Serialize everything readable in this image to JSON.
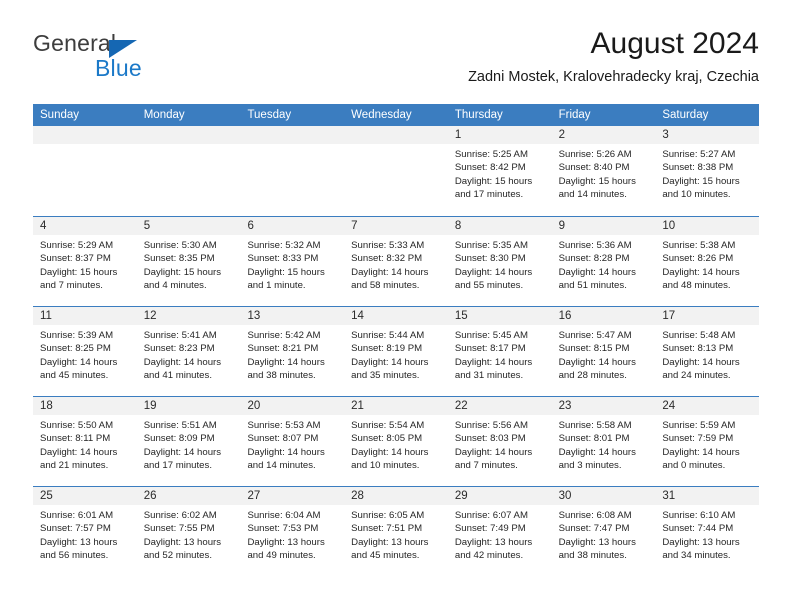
{
  "brand": {
    "name_top": "General",
    "name_bottom": "Blue",
    "triangle_color": "#1567b3",
    "blue_color": "#1b79c8"
  },
  "header": {
    "title": "August 2024",
    "location": "Zadni Mostek, Kralovehradecky kraj, Czechia"
  },
  "theme": {
    "header_row_color": "#3b7dc0",
    "day_band_color": "#f2f2f2",
    "rule_color": "#3b7dc0"
  },
  "calendar": {
    "weekdays": [
      "Sunday",
      "Monday",
      "Tuesday",
      "Wednesday",
      "Thursday",
      "Friday",
      "Saturday"
    ],
    "weeks": [
      [
        {
          "day": "",
          "empty": true
        },
        {
          "day": "",
          "empty": true
        },
        {
          "day": "",
          "empty": true
        },
        {
          "day": "",
          "empty": true
        },
        {
          "day": "1",
          "sunrise": "Sunrise: 5:25 AM",
          "sunset": "Sunset: 8:42 PM",
          "daylight1": "Daylight: 15 hours",
          "daylight2": "and 17 minutes."
        },
        {
          "day": "2",
          "sunrise": "Sunrise: 5:26 AM",
          "sunset": "Sunset: 8:40 PM",
          "daylight1": "Daylight: 15 hours",
          "daylight2": "and 14 minutes."
        },
        {
          "day": "3",
          "sunrise": "Sunrise: 5:27 AM",
          "sunset": "Sunset: 8:38 PM",
          "daylight1": "Daylight: 15 hours",
          "daylight2": "and 10 minutes."
        }
      ],
      [
        {
          "day": "4",
          "sunrise": "Sunrise: 5:29 AM",
          "sunset": "Sunset: 8:37 PM",
          "daylight1": "Daylight: 15 hours",
          "daylight2": "and 7 minutes."
        },
        {
          "day": "5",
          "sunrise": "Sunrise: 5:30 AM",
          "sunset": "Sunset: 8:35 PM",
          "daylight1": "Daylight: 15 hours",
          "daylight2": "and 4 minutes."
        },
        {
          "day": "6",
          "sunrise": "Sunrise: 5:32 AM",
          "sunset": "Sunset: 8:33 PM",
          "daylight1": "Daylight: 15 hours",
          "daylight2": "and 1 minute."
        },
        {
          "day": "7",
          "sunrise": "Sunrise: 5:33 AM",
          "sunset": "Sunset: 8:32 PM",
          "daylight1": "Daylight: 14 hours",
          "daylight2": "and 58 minutes."
        },
        {
          "day": "8",
          "sunrise": "Sunrise: 5:35 AM",
          "sunset": "Sunset: 8:30 PM",
          "daylight1": "Daylight: 14 hours",
          "daylight2": "and 55 minutes."
        },
        {
          "day": "9",
          "sunrise": "Sunrise: 5:36 AM",
          "sunset": "Sunset: 8:28 PM",
          "daylight1": "Daylight: 14 hours",
          "daylight2": "and 51 minutes."
        },
        {
          "day": "10",
          "sunrise": "Sunrise: 5:38 AM",
          "sunset": "Sunset: 8:26 PM",
          "daylight1": "Daylight: 14 hours",
          "daylight2": "and 48 minutes."
        }
      ],
      [
        {
          "day": "11",
          "sunrise": "Sunrise: 5:39 AM",
          "sunset": "Sunset: 8:25 PM",
          "daylight1": "Daylight: 14 hours",
          "daylight2": "and 45 minutes."
        },
        {
          "day": "12",
          "sunrise": "Sunrise: 5:41 AM",
          "sunset": "Sunset: 8:23 PM",
          "daylight1": "Daylight: 14 hours",
          "daylight2": "and 41 minutes."
        },
        {
          "day": "13",
          "sunrise": "Sunrise: 5:42 AM",
          "sunset": "Sunset: 8:21 PM",
          "daylight1": "Daylight: 14 hours",
          "daylight2": "and 38 minutes."
        },
        {
          "day": "14",
          "sunrise": "Sunrise: 5:44 AM",
          "sunset": "Sunset: 8:19 PM",
          "daylight1": "Daylight: 14 hours",
          "daylight2": "and 35 minutes."
        },
        {
          "day": "15",
          "sunrise": "Sunrise: 5:45 AM",
          "sunset": "Sunset: 8:17 PM",
          "daylight1": "Daylight: 14 hours",
          "daylight2": "and 31 minutes."
        },
        {
          "day": "16",
          "sunrise": "Sunrise: 5:47 AM",
          "sunset": "Sunset: 8:15 PM",
          "daylight1": "Daylight: 14 hours",
          "daylight2": "and 28 minutes."
        },
        {
          "day": "17",
          "sunrise": "Sunrise: 5:48 AM",
          "sunset": "Sunset: 8:13 PM",
          "daylight1": "Daylight: 14 hours",
          "daylight2": "and 24 minutes."
        }
      ],
      [
        {
          "day": "18",
          "sunrise": "Sunrise: 5:50 AM",
          "sunset": "Sunset: 8:11 PM",
          "daylight1": "Daylight: 14 hours",
          "daylight2": "and 21 minutes."
        },
        {
          "day": "19",
          "sunrise": "Sunrise: 5:51 AM",
          "sunset": "Sunset: 8:09 PM",
          "daylight1": "Daylight: 14 hours",
          "daylight2": "and 17 minutes."
        },
        {
          "day": "20",
          "sunrise": "Sunrise: 5:53 AM",
          "sunset": "Sunset: 8:07 PM",
          "daylight1": "Daylight: 14 hours",
          "daylight2": "and 14 minutes."
        },
        {
          "day": "21",
          "sunrise": "Sunrise: 5:54 AM",
          "sunset": "Sunset: 8:05 PM",
          "daylight1": "Daylight: 14 hours",
          "daylight2": "and 10 minutes."
        },
        {
          "day": "22",
          "sunrise": "Sunrise: 5:56 AM",
          "sunset": "Sunset: 8:03 PM",
          "daylight1": "Daylight: 14 hours",
          "daylight2": "and 7 minutes."
        },
        {
          "day": "23",
          "sunrise": "Sunrise: 5:58 AM",
          "sunset": "Sunset: 8:01 PM",
          "daylight1": "Daylight: 14 hours",
          "daylight2": "and 3 minutes."
        },
        {
          "day": "24",
          "sunrise": "Sunrise: 5:59 AM",
          "sunset": "Sunset: 7:59 PM",
          "daylight1": "Daylight: 14 hours",
          "daylight2": "and 0 minutes."
        }
      ],
      [
        {
          "day": "25",
          "sunrise": "Sunrise: 6:01 AM",
          "sunset": "Sunset: 7:57 PM",
          "daylight1": "Daylight: 13 hours",
          "daylight2": "and 56 minutes."
        },
        {
          "day": "26",
          "sunrise": "Sunrise: 6:02 AM",
          "sunset": "Sunset: 7:55 PM",
          "daylight1": "Daylight: 13 hours",
          "daylight2": "and 52 minutes."
        },
        {
          "day": "27",
          "sunrise": "Sunrise: 6:04 AM",
          "sunset": "Sunset: 7:53 PM",
          "daylight1": "Daylight: 13 hours",
          "daylight2": "and 49 minutes."
        },
        {
          "day": "28",
          "sunrise": "Sunrise: 6:05 AM",
          "sunset": "Sunset: 7:51 PM",
          "daylight1": "Daylight: 13 hours",
          "daylight2": "and 45 minutes."
        },
        {
          "day": "29",
          "sunrise": "Sunrise: 6:07 AM",
          "sunset": "Sunset: 7:49 PM",
          "daylight1": "Daylight: 13 hours",
          "daylight2": "and 42 minutes."
        },
        {
          "day": "30",
          "sunrise": "Sunrise: 6:08 AM",
          "sunset": "Sunset: 7:47 PM",
          "daylight1": "Daylight: 13 hours",
          "daylight2": "and 38 minutes."
        },
        {
          "day": "31",
          "sunrise": "Sunrise: 6:10 AM",
          "sunset": "Sunset: 7:44 PM",
          "daylight1": "Daylight: 13 hours",
          "daylight2": "and 34 minutes."
        }
      ]
    ]
  }
}
